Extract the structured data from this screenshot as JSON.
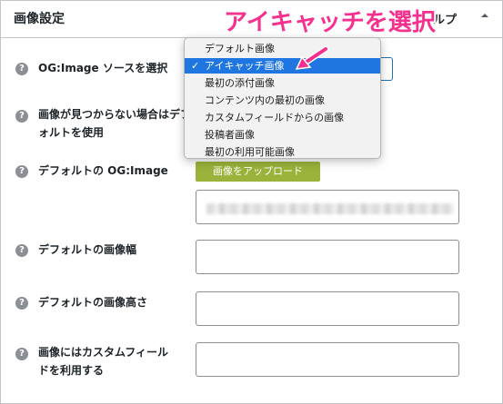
{
  "panel": {
    "title": "画像設定",
    "header_help_partial": "ルプ"
  },
  "help_icon_glyph": "?",
  "fields": [
    {
      "label": "OG:Image ソースを選択"
    },
    {
      "label": "画像が見つからない場合はデフォルトを使用"
    },
    {
      "label": "デフォルトの OG:Image"
    },
    {
      "label": "デフォルトの画像幅"
    },
    {
      "label": "デフォルトの画像高さ"
    },
    {
      "label": "画像にはカスタムフィールドを利用する"
    }
  ],
  "upload_button_label": "画像をアップロード",
  "dropdown": {
    "options": [
      "デフォルト画像",
      "アイキャッチ画像",
      "最初の添付画像",
      "コンテンツ内の最初の画像",
      "カスタムフィールドからの画像",
      "投稿者画像",
      "最初の利用可能画像"
    ],
    "selected_option": "アイキャッチ画像",
    "check_glyph": "✓"
  },
  "annotation": {
    "text": "アイキャッチを選択",
    "color": "#f5308e"
  },
  "colors": {
    "accent_blue": "#1f76e0",
    "upload_green": "#9ab33a"
  }
}
